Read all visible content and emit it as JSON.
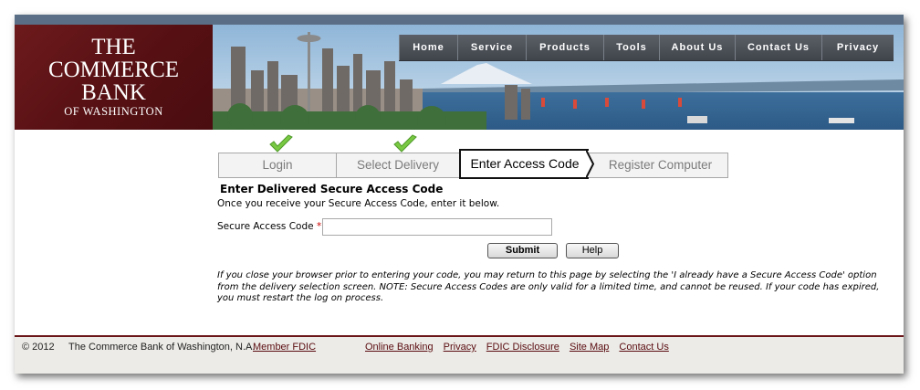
{
  "header": {
    "logo": {
      "line1": "THE",
      "line2": "COMMERCE",
      "line3": "BANK",
      "line4": "OF WASHINGTON"
    },
    "nav": [
      {
        "label": "Home",
        "w": 0
      },
      {
        "label": "Service"
      },
      {
        "label": "Products"
      },
      {
        "label": "Tools"
      },
      {
        "label": "About Us"
      },
      {
        "label": "Contact Us"
      },
      {
        "label": "Privacy"
      }
    ]
  },
  "steps": [
    {
      "label": "Login",
      "completed": true
    },
    {
      "label": "Select Delivery",
      "completed": true
    },
    {
      "label": "Enter Access Code",
      "active": true
    },
    {
      "label": "Register Computer"
    }
  ],
  "form": {
    "title": "Enter Delivered Secure Access Code",
    "subtitle": "Once you receive your Secure Access Code, enter it below.",
    "field_label": "Secure Access Code",
    "required_mark": "*",
    "field_value": "",
    "submit_label": "Submit",
    "help_label": "Help",
    "note": "If you close your browser prior to entering your code, you may return to this page by selecting the 'I already have a Secure Access Code' option from the delivery selection screen. NOTE: Secure Access Codes are only valid for a limited time, and cannot be reused. If your code has expired, you must restart the log on process."
  },
  "footer": {
    "copyright": "© 2012",
    "bank_name": "The Commerce Bank of Washington, N.A.",
    "member_fdic": "Member FDIC",
    "links": [
      "Online Banking",
      "Privacy",
      "FDIC Disclosure",
      "Site Map",
      "Contact Us"
    ]
  },
  "colors": {
    "brand_maroon": "#5a0f12",
    "nav_gray": "#4a5058",
    "check_green": "#7ac943"
  }
}
